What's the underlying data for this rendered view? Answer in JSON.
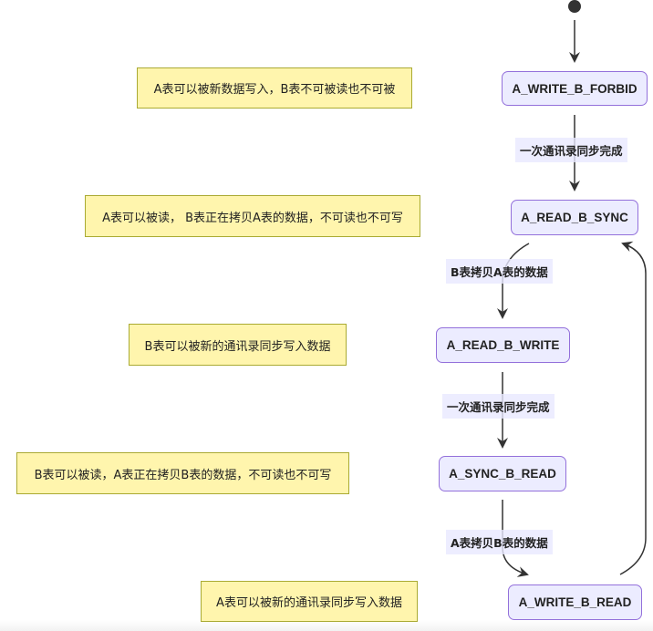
{
  "diagram": {
    "type": "state-diagram",
    "start_node": "start",
    "states": [
      {
        "id": "A_WRITE_B_FORBID",
        "label": "A_WRITE_B_FORBID",
        "note": "A表可以被新数据写入，B表不可被读也不可被"
      },
      {
        "id": "A_READ_B_SYNC",
        "label": "A_READ_B_SYNC",
        "note": "A表可以被读， B表正在拷贝A表的数据，不可读也不可写"
      },
      {
        "id": "A_READ_B_WRITE",
        "label": "A_READ_B_WRITE",
        "note": "B表可以被新的通讯录同步写入数据"
      },
      {
        "id": "A_SYNC_B_READ",
        "label": "A_SYNC_B_READ",
        "note": "B表可以被读，A表正在拷贝B表的数据，不可读也不可写"
      },
      {
        "id": "A_WRITE_B_READ",
        "label": "A_WRITE_B_READ",
        "note": "A表可以被新的通讯录同步写入数据"
      }
    ],
    "transitions": [
      {
        "from": "start",
        "to": "A_WRITE_B_FORBID",
        "label": ""
      },
      {
        "from": "A_WRITE_B_FORBID",
        "to": "A_READ_B_SYNC",
        "label": "一次通讯录同步完成"
      },
      {
        "from": "A_READ_B_SYNC",
        "to": "A_READ_B_WRITE",
        "label": "B表拷贝A表的数据"
      },
      {
        "from": "A_READ_B_WRITE",
        "to": "A_SYNC_B_READ",
        "label": "一次通讯录同步完成"
      },
      {
        "from": "A_SYNC_B_READ",
        "to": "A_WRITE_B_READ",
        "label": "A表拷贝B表的数据"
      },
      {
        "from": "A_WRITE_B_READ",
        "to": "A_READ_B_SYNC",
        "label": ""
      }
    ],
    "colors": {
      "state_fill": "#ececff",
      "state_border": "#9370db",
      "note_fill": "#fff5ad",
      "note_border": "#aaaa33",
      "edge": "#333333",
      "edge_label_bg": "#e8e8ff"
    }
  }
}
